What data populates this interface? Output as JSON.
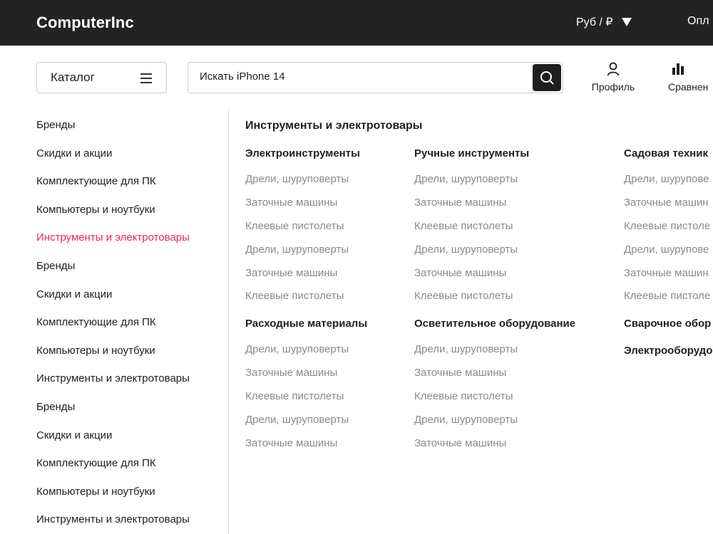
{
  "header": {
    "logo": "ComputerInc",
    "currency": "Руб / ₽",
    "link": "Опл"
  },
  "toolbar": {
    "catalog_label": "Каталог",
    "search_value": "Искать iPhone 14",
    "profile_label": "Профиль",
    "compare_label": "Сравнен"
  },
  "sidebar": {
    "items": [
      "Бренды",
      "Скидки и акции",
      "Комплектующие для ПК",
      "Компьютеры и ноутбуки",
      "Инструменты и электротовары",
      "Бренды",
      "Скидки и акции",
      "Комплектующие для ПК",
      "Компьютеры и ноутбуки",
      "Инструменты и электротовары",
      "Бренды",
      "Скидки и акции",
      "Комплектующие для ПК",
      "Компьютеры и ноутбуки",
      "Инструменты и электротовары"
    ],
    "active_index": 4
  },
  "menu": {
    "title": "Инструменты и электротовары",
    "groups": [
      {
        "title": "Электроинструменты",
        "items": [
          "Дрели, шуруповерты",
          "Заточные машины",
          "Клеевые пистолеты",
          "Дрели, шуруповерты",
          "Заточные машины",
          "Клеевые пистолеты"
        ]
      },
      {
        "title": "Ручные инструменты",
        "items": [
          "Дрели, шуруповерты",
          "Заточные машины",
          "Клеевые пистолеты",
          "Дрели, шуруповерты",
          "Заточные машины",
          "Клеевые пистолеты"
        ]
      },
      {
        "title": "Садовая техник",
        "items": [
          "Дрели, шурупове",
          "Заточные машин",
          "Клеевые пистоле",
          "Дрели, шурупове",
          "Заточные машин",
          "Клеевые пистоле"
        ]
      },
      {
        "title": "Расходные материалы",
        "items": [
          "Дрели, шуруповерты",
          "Заточные машины",
          "Клеевые пистолеты",
          "Дрели, шуруповерты",
          "Заточные машины"
        ]
      },
      {
        "title": "Осветительное оборудование",
        "items": [
          "Дрели, шуруповерты",
          "Заточные машины",
          "Клеевые пистолеты",
          "Дрели, шуруповерты",
          "Заточные машины"
        ]
      },
      {
        "title": "Сварочное обор",
        "items": []
      },
      {
        "title": "Электрооборудо",
        "items": []
      }
    ]
  },
  "colors": {
    "topbar": "#232323",
    "accent": "#e6246f",
    "muted_text": "#8a8a8a"
  },
  "icons": [
    "menu-icon",
    "search-icon",
    "user-icon",
    "bar-chart-icon",
    "caret-down-icon"
  ]
}
